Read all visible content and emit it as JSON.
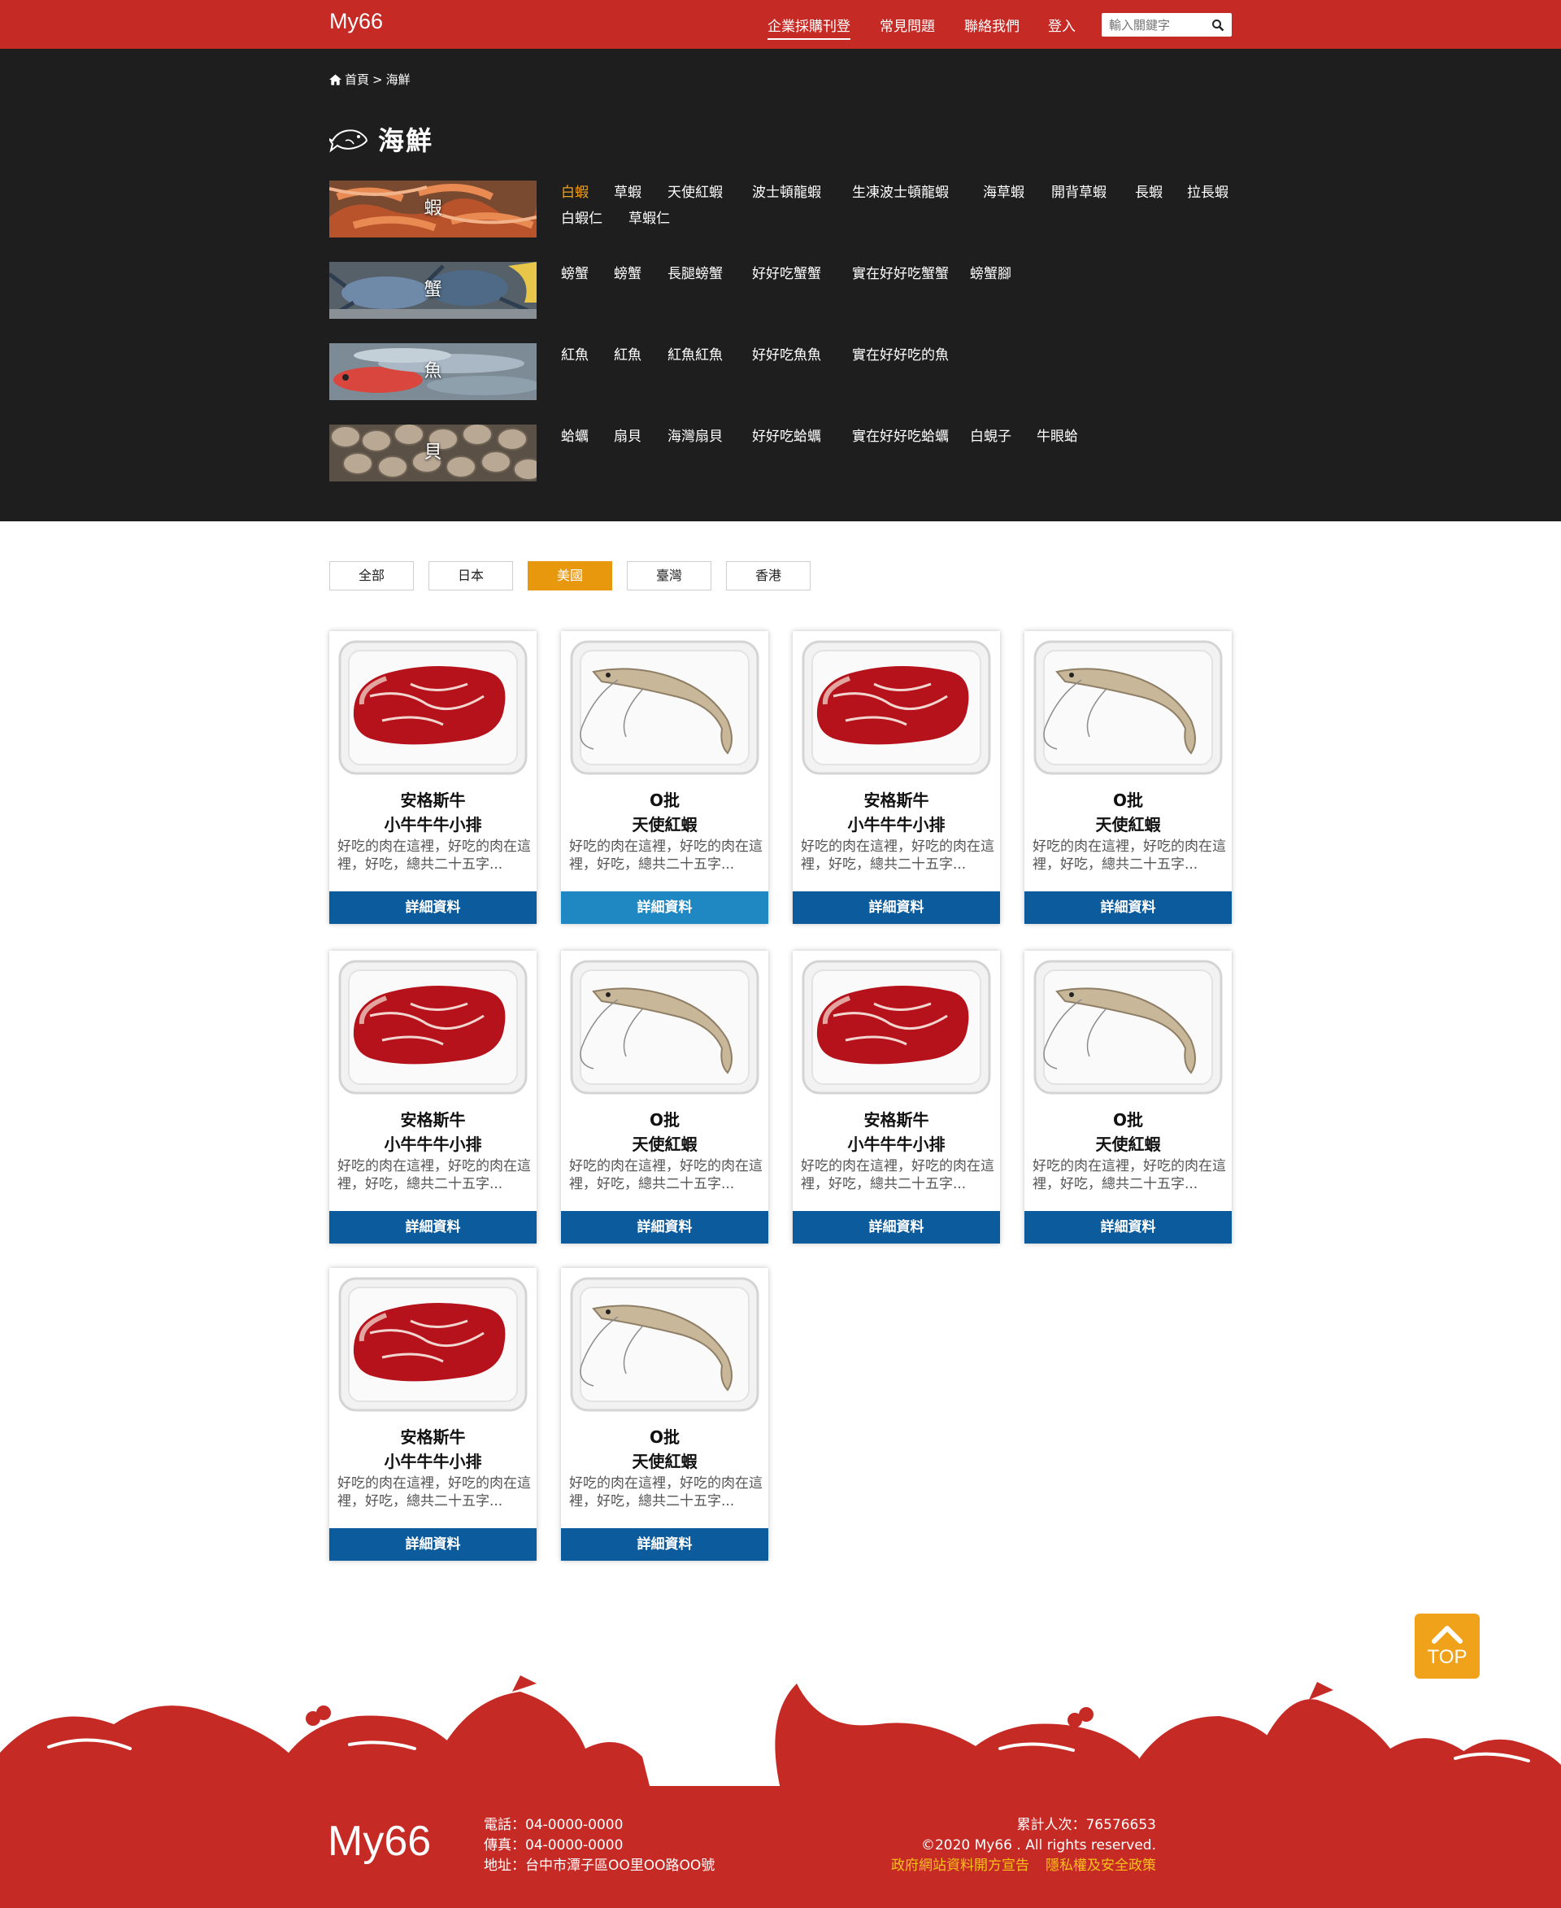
{
  "header": {
    "logo": "My66",
    "nav": [
      "企業採購刊登",
      "常見問題",
      "聯絡我們",
      "登入"
    ],
    "search_placeholder": "輸入關鍵字"
  },
  "breadcrumb": {
    "home": "首頁",
    "sep": ">",
    "current": "海鮮"
  },
  "page_title": "海鮮",
  "categories": [
    {
      "label": "蝦",
      "items": [
        "白蝦",
        "草蝦",
        "天使紅蝦",
        "波士頓龍蝦",
        "生凍波士頓龍蝦",
        "海草蝦",
        "開背草蝦",
        "長蝦",
        "拉長蝦",
        "白蝦仁",
        "草蝦仁"
      ]
    },
    {
      "label": "蟹",
      "items": [
        "螃蟹",
        "螃蟹",
        "長腿螃蟹",
        "好好吃蟹蟹",
        "實在好好吃蟹蟹",
        "螃蟹腳"
      ]
    },
    {
      "label": "魚",
      "items": [
        "紅魚",
        "紅魚",
        "紅魚紅魚",
        "好好吃魚魚",
        "實在好好吃的魚"
      ]
    },
    {
      "label": "貝",
      "items": [
        "蛤蠣",
        "扇貝",
        "海灣扇貝",
        "好好吃蛤蠣",
        "實在好好吃蛤蠣",
        "白蜆子",
        "牛眼蛤"
      ]
    }
  ],
  "filters": [
    "全部",
    "日本",
    "美國",
    "臺灣",
    "香港"
  ],
  "active_filter": "美國",
  "products": [
    {
      "type": "beef",
      "line1": "安格斯牛",
      "line2": "小牛牛牛小排",
      "desc": "好吃的肉在這裡，好吃的肉在這裡，好吃，總共二十五字...",
      "button": "詳細資料"
    },
    {
      "type": "shrimp",
      "line1": "O批",
      "line2": "天使紅蝦",
      "desc": "好吃的肉在這裡，好吃的肉在這裡，好吃，總共二十五字...",
      "button": "詳細資料"
    },
    {
      "type": "beef",
      "line1": "安格斯牛",
      "line2": "小牛牛牛小排",
      "desc": "好吃的肉在這裡，好吃的肉在這裡，好吃，總共二十五字...",
      "button": "詳細資料"
    },
    {
      "type": "shrimp",
      "line1": "O批",
      "line2": "天使紅蝦",
      "desc": "好吃的肉在這裡，好吃的肉在這裡，好吃，總共二十五字...",
      "button": "詳細資料"
    },
    {
      "type": "beef",
      "line1": "安格斯牛",
      "line2": "小牛牛牛小排",
      "desc": "好吃的肉在這裡，好吃的肉在這裡，好吃，總共二十五字...",
      "button": "詳細資料"
    },
    {
      "type": "shrimp",
      "line1": "O批",
      "line2": "天使紅蝦",
      "desc": "好吃的肉在這裡，好吃的肉在這裡，好吃，總共二十五字...",
      "button": "詳細資料"
    },
    {
      "type": "beef",
      "line1": "安格斯牛",
      "line2": "小牛牛牛小排",
      "desc": "好吃的肉在這裡，好吃的肉在這裡，好吃，總共二十五字...",
      "button": "詳細資料"
    },
    {
      "type": "shrimp",
      "line1": "O批",
      "line2": "天使紅蝦",
      "desc": "好吃的肉在這裡，好吃的肉在這裡，好吃，總共二十五字...",
      "button": "詳細資料"
    },
    {
      "type": "beef",
      "line1": "安格斯牛",
      "line2": "小牛牛牛小排",
      "desc": "好吃的肉在這裡，好吃的肉在這裡，好吃，總共二十五字...",
      "button": "詳細資料"
    },
    {
      "type": "shrimp",
      "line1": "O批",
      "line2": "天使紅蝦",
      "desc": "好吃的肉在這裡，好吃的肉在這裡，好吃，總共二十五字...",
      "button": "詳細資料"
    }
  ],
  "top_button": "TOP",
  "footer": {
    "logo": "My66",
    "phone": "電話：04-0000-0000",
    "fax": "傳真：04-0000-0000",
    "address": "地址：台中市潭子區OO里OO路OO號",
    "visitors": "累計人次：76576653",
    "copyright": "©2020 My66 . All rights reserved.",
    "link_open_data": "政府網站資料開方宣告",
    "link_privacy": "隱私權及安全政策"
  },
  "colors": {
    "brand_red": "#c62a25",
    "accent_orange": "#e8980c",
    "button_blue": "#0c5b9c",
    "dark_band": "#1e1e1e"
  }
}
